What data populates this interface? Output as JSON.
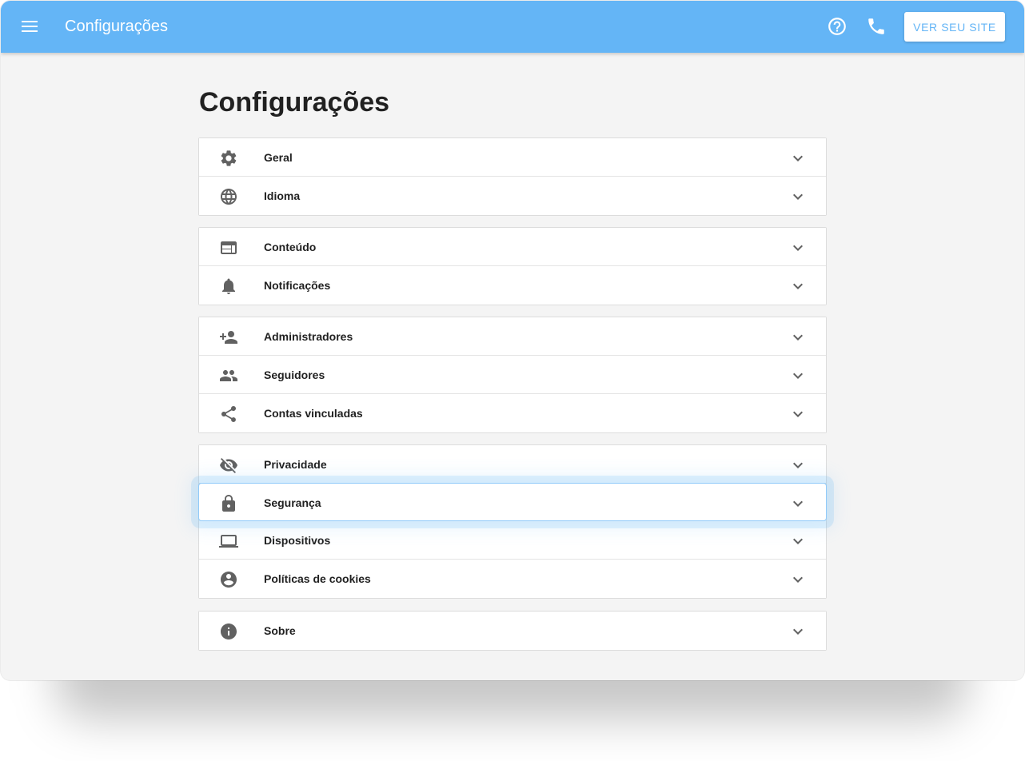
{
  "appbar": {
    "title": "Configurações",
    "menu_icon": "menu-icon",
    "help_icon": "help-circle-icon",
    "phone_icon": "phone-icon",
    "site_button_label": "VER SEU SITE",
    "color": "#64b5f6"
  },
  "page": {
    "title": "Configurações"
  },
  "groups": [
    {
      "items": [
        {
          "label": "Geral",
          "icon": "gear-icon"
        },
        {
          "label": "Idioma",
          "icon": "globe-icon"
        }
      ]
    },
    {
      "items": [
        {
          "label": "Conteúdo",
          "icon": "web-layout-icon"
        },
        {
          "label": "Notificações",
          "icon": "bell-icon"
        }
      ]
    },
    {
      "items": [
        {
          "label": "Administradores",
          "icon": "person-add-icon"
        },
        {
          "label": "Seguidores",
          "icon": "people-icon"
        },
        {
          "label": "Contas vinculadas",
          "icon": "share-icon"
        }
      ]
    },
    {
      "items": [
        {
          "label": "Privacidade",
          "icon": "eye-off-icon"
        },
        {
          "label": "Segurança",
          "icon": "lock-icon",
          "focused": true
        },
        {
          "label": "Dispositivos",
          "icon": "laptop-icon"
        },
        {
          "label": "Políticas de cookies",
          "icon": "account-circle-icon"
        }
      ]
    },
    {
      "items": [
        {
          "label": "Sobre",
          "icon": "info-icon"
        }
      ]
    }
  ],
  "colors": {
    "focus": "#90caf9",
    "icon": "#616161"
  }
}
